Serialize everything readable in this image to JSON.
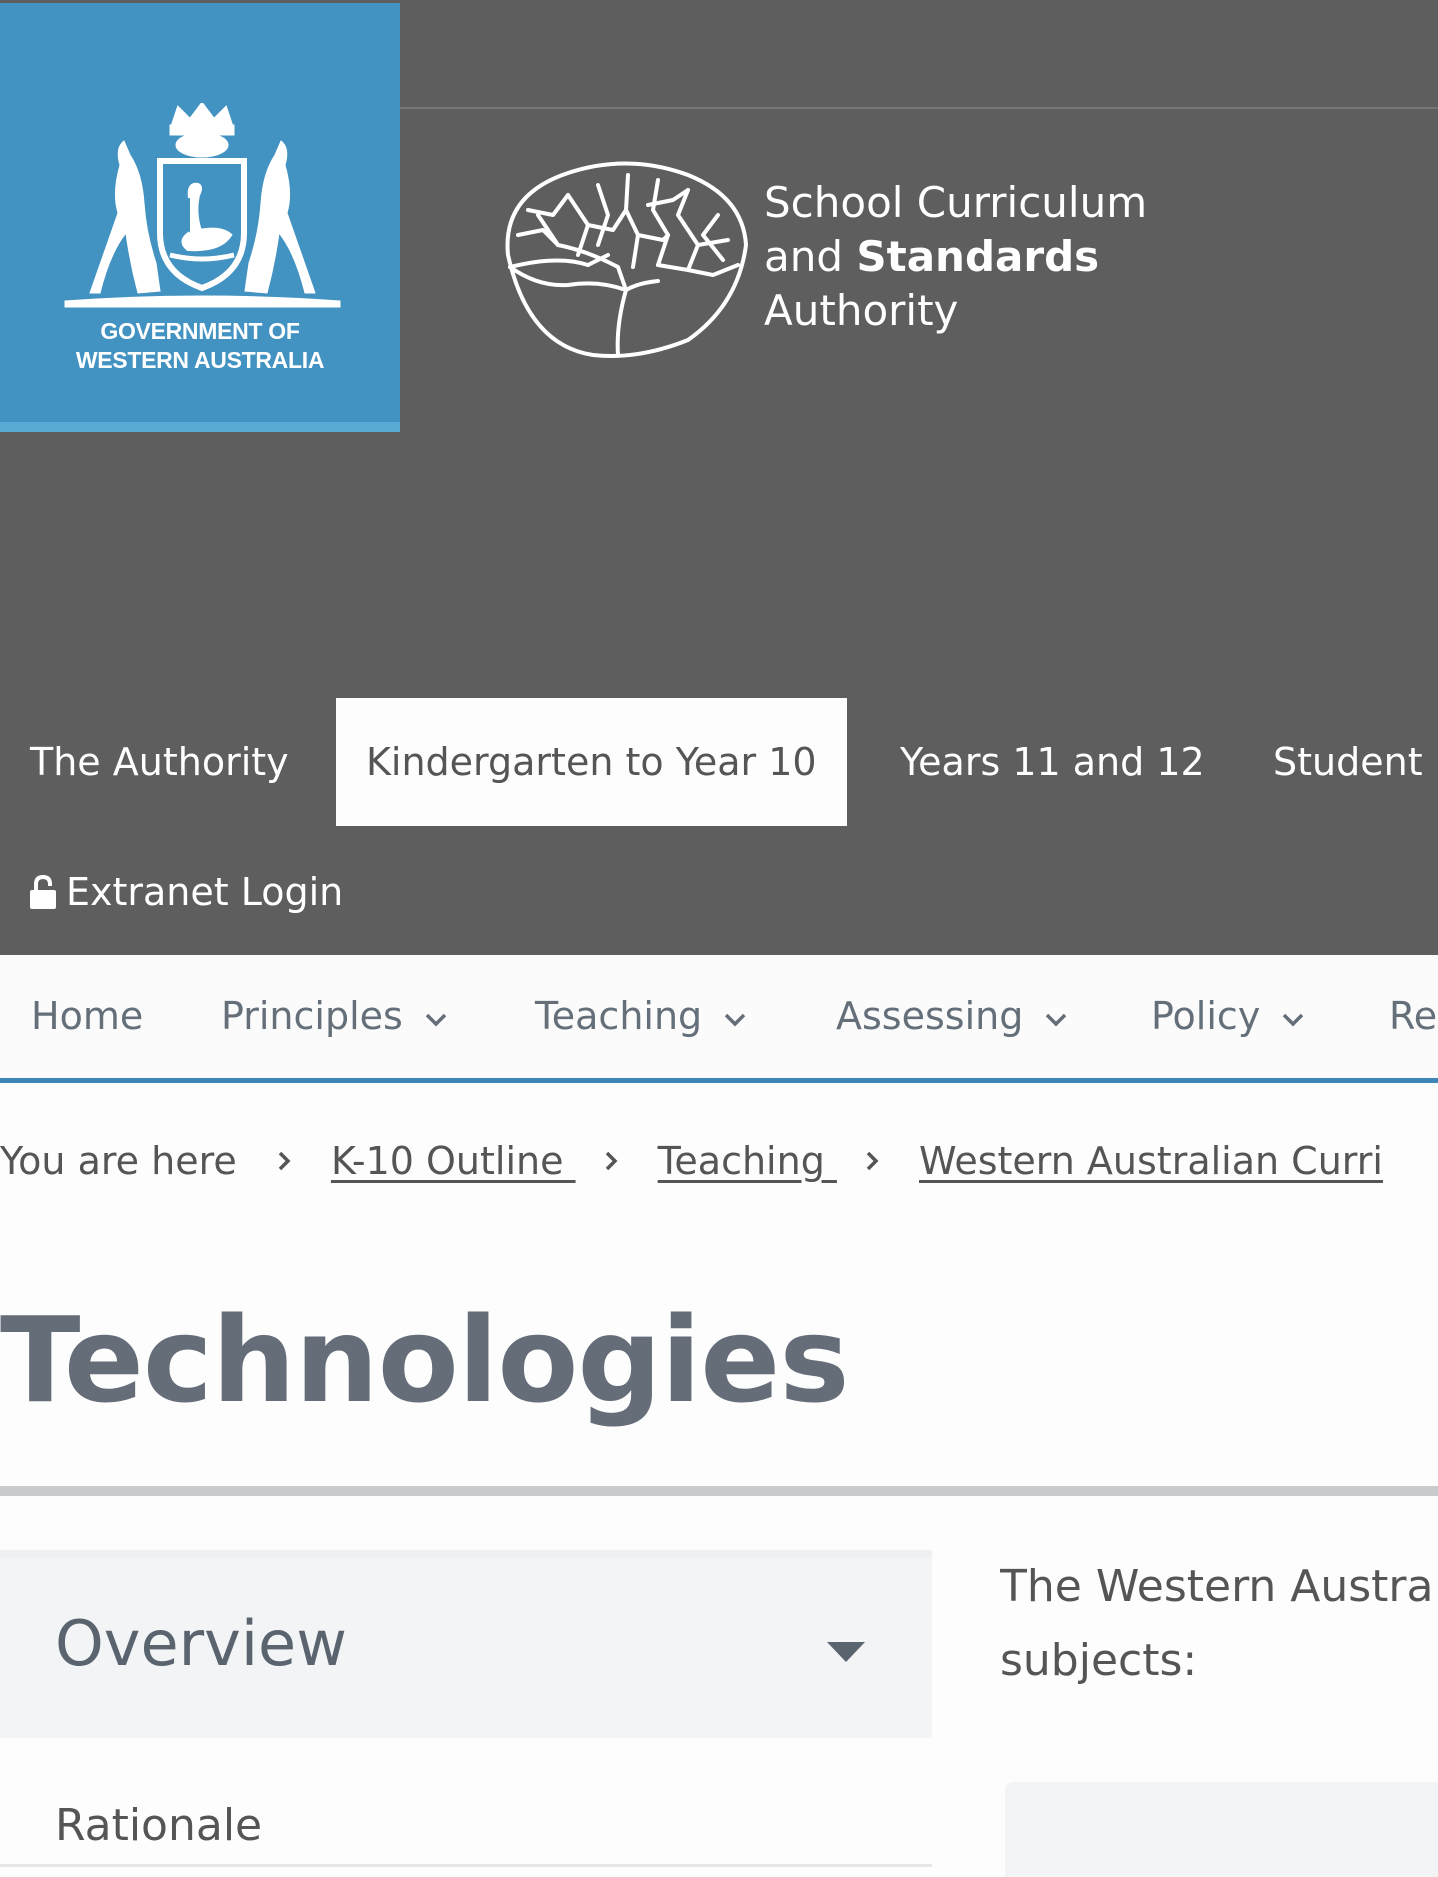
{
  "gov_badge": {
    "line1": "GOVERNMENT OF",
    "line2": "WESTERN AUSTRALIA",
    "color": "#4292c2"
  },
  "scsa": {
    "line1": "School Curriculum",
    "line2_a": "and ",
    "line2_b": "Standards",
    "line3": "Authority"
  },
  "main_nav": {
    "items": [
      {
        "label": "The Authority"
      },
      {
        "label": "Kindergarten to Year 10",
        "active": true
      },
      {
        "label": "Years 11 and 12"
      },
      {
        "label": "Student"
      }
    ],
    "extranet_label": "Extranet Login",
    "extranet_icon": "lock-open-icon"
  },
  "sub_nav": {
    "items": [
      {
        "label": "Home"
      },
      {
        "label": "Principles",
        "icon": "chevron-down-icon"
      },
      {
        "label": "Teaching",
        "icon": "chevron-down-icon"
      },
      {
        "label": "Assessing",
        "icon": "chevron-down-icon"
      },
      {
        "label": "Policy",
        "icon": "chevron-down-icon"
      },
      {
        "label": "Re"
      }
    ],
    "accent": "#3d86b6"
  },
  "breadcrumb": {
    "prefix": "You are here",
    "links": [
      "K-10 Outline ",
      "Teaching ",
      "Western Australian Curri"
    ]
  },
  "page": {
    "title": "Technologies"
  },
  "sidebar": {
    "overview_label": "Overview",
    "rationale_label": "Rationale"
  },
  "content": {
    "intro_line1": "The Western Austra",
    "intro_line2": "subjects:"
  }
}
